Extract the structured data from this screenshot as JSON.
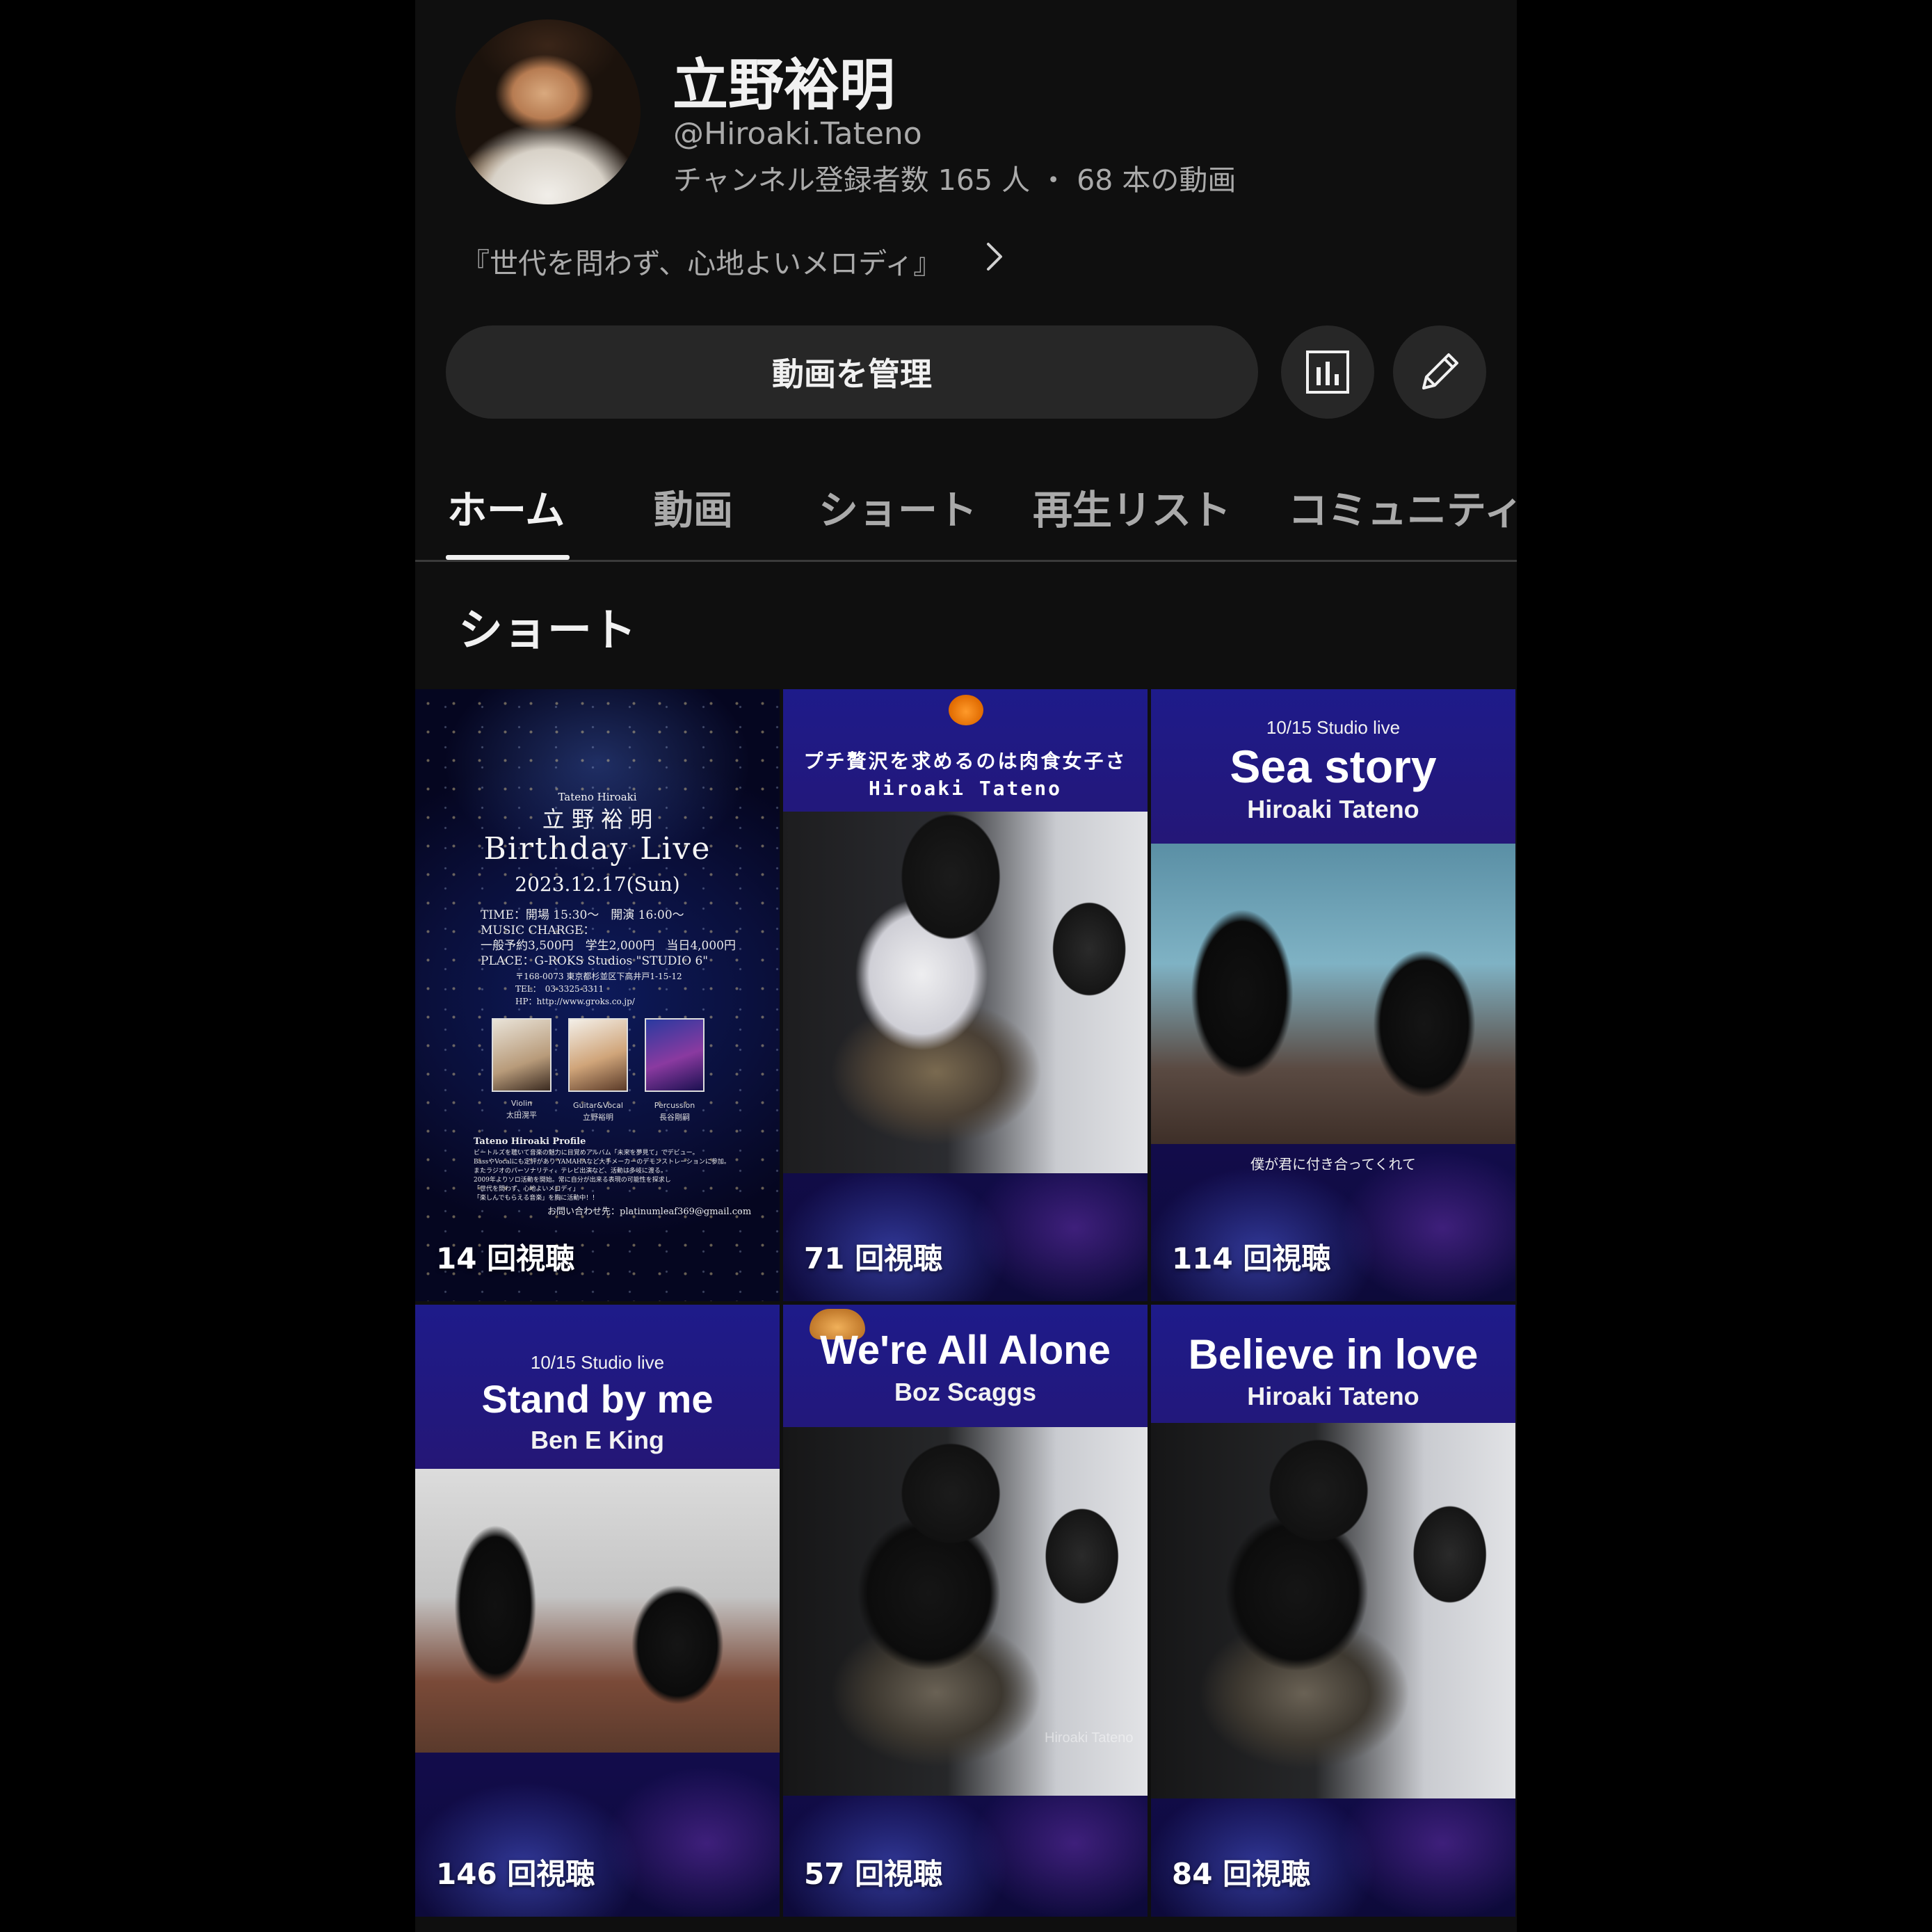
{
  "channel": {
    "name": "立野裕明",
    "handle": "@Hiroaki.Tateno",
    "stats": "チャンネル登録者数 165 人 ・ 68 本の動画",
    "description": "『世代を問わず、心地よいメロディ』"
  },
  "actions": {
    "manage_label": "動画を管理"
  },
  "tabs": [
    {
      "label": "ホーム",
      "active": true
    },
    {
      "label": "動画"
    },
    {
      "label": "ショート"
    },
    {
      "label": "再生リスト"
    },
    {
      "label": "コミュニティ"
    }
  ],
  "section": {
    "title": "ショート"
  },
  "shorts": [
    {
      "views": "14 回視聴",
      "poster": {
        "romaji": "Tateno  Hiroaki",
        "name": "立 野 裕 明",
        "title": "Birthday Live",
        "date": "2023.12.17(Sun)",
        "time": "TIME：開場 15:30〜　開演 16:00〜",
        "charge_label": "MUSIC CHARGE：",
        "charge": "一般予約3,500円　学生2,000円　当日4,000円",
        "place": "PLACE：G-ROKS Studios \"STUDIO 6\"",
        "address": "〒168-0073 東京都杉並区下高井戸1-15-12",
        "tel": "TEL：　03-3325-3311",
        "hp": "HP：http://www.groks.co.jp/",
        "members": [
          {
            "part": "Violin",
            "name": "太田滉平"
          },
          {
            "part": "Guitar&Vocal",
            "name": "立野裕明"
          },
          {
            "part": "Percussion",
            "name": "長谷剛嗣"
          }
        ],
        "profile_title": "Tateno Hiroaki Profile",
        "profile_lines": [
          "ビートルズを聴いて音楽の魅力に目覚めアルバム「未来を夢見て」でデビュー。",
          "BassやVocalにも定評があり YAMAHAなど大手メーカーのデモンストレーションに参加。",
          "またラジオのパーソナリティ、テレビ出演など、活動は多岐に渡る。",
          "2009年よりソロ活動を開始。常に自分が出来る表現の可能性を探求し",
          "「世代を問わず、心地よいメロディ」",
          "「楽しんでもらえる音楽」を胸に活動中！！"
        ],
        "contact": "お問い合わせ先：platinumleaf369@gmail.com"
      }
    },
    {
      "views": "71 回視聴",
      "overlay_title": "プチ贅沢を求めるのは肉食女子さ",
      "overlay_sub": "Hiroaki Tateno"
    },
    {
      "views": "114 回視聴",
      "overlay_small": "10/15 Studio live",
      "overlay_title": "Sea story",
      "overlay_sub": "Hiroaki Tateno",
      "caption": "僕が君に付き合ってくれて"
    },
    {
      "views": "146 回視聴",
      "overlay_small": "10/15 Studio live",
      "overlay_title": "Stand by me",
      "overlay_sub": "Ben E King"
    },
    {
      "views": "57 回視聴",
      "overlay_title": "We're All Alone",
      "overlay_sub": "Boz Scaggs",
      "watermark": "Hiroaki Tateno"
    },
    {
      "views": "84 回視聴",
      "overlay_title": "Believe in love",
      "overlay_sub": "Hiroaki Tateno"
    }
  ],
  "icons": {
    "desc_more": "chevron-right-icon",
    "analytics": "bar-chart-icon",
    "edit": "pencil-icon"
  }
}
